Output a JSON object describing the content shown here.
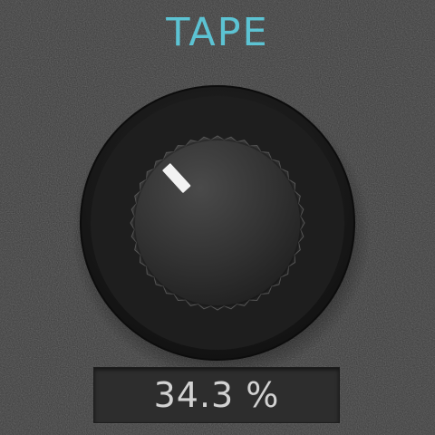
{
  "plugin": {
    "control_title": "TAPE",
    "value_display": "34.3 %",
    "knob_value_fraction": 0.343
  },
  "colors": {
    "title": "#5cc3d3",
    "panel_background": "#3a3a3a",
    "knob_body": "#2c2c2c",
    "indicator": "#f2f2f2",
    "value_text": "#d2d2d2"
  },
  "icons": {
    "knob": "rotary-knob-icon",
    "indicator": "knob-indicator-icon"
  }
}
